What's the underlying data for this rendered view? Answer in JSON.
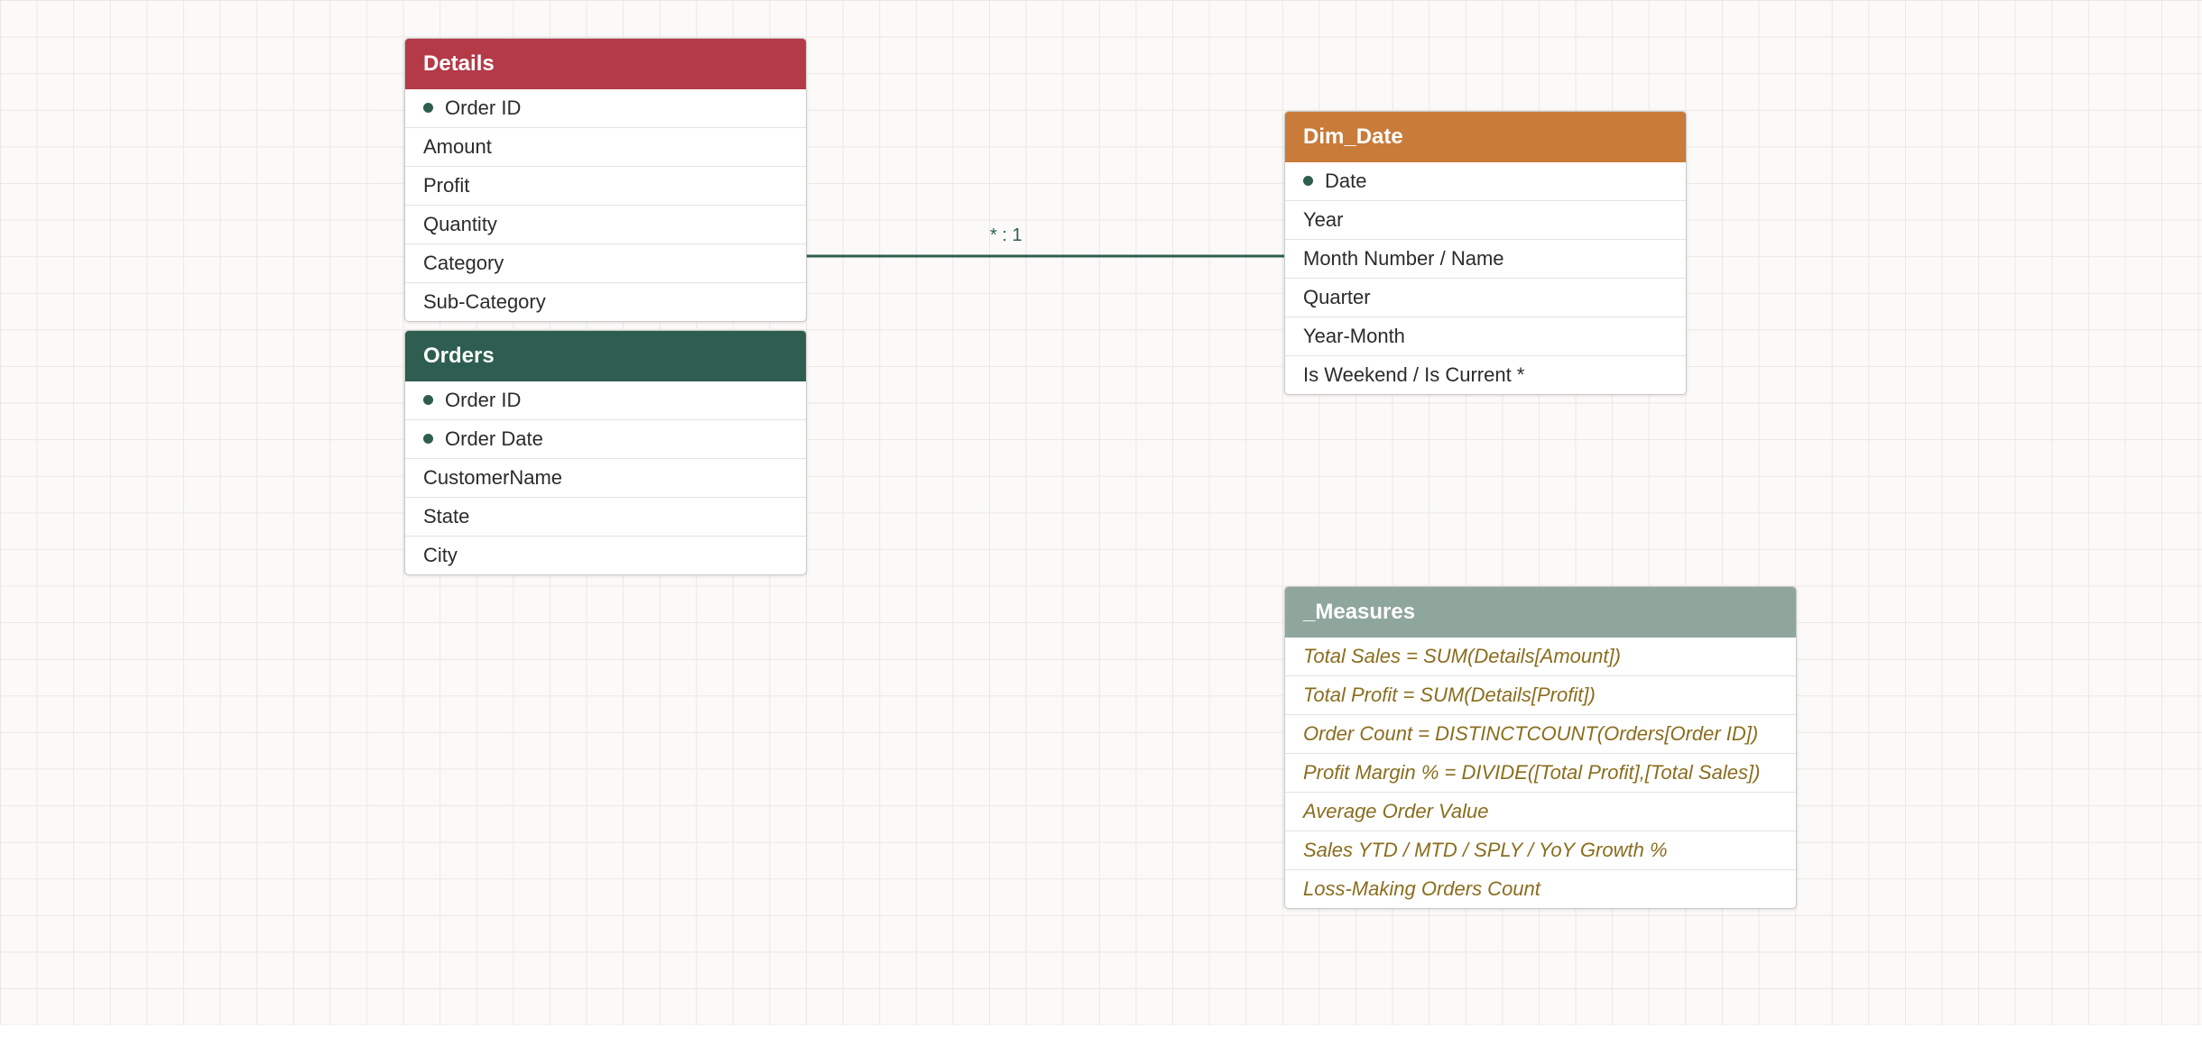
{
  "colors": {
    "key_dot": "#2d5e4f",
    "relationship_line": "#2d5e4f",
    "measure_text": "#8a6d1e"
  },
  "tables": {
    "details": {
      "title": "Details",
      "header_color": "#b43a48",
      "fields": [
        {
          "label": "Order ID",
          "key": true
        },
        {
          "label": "Amount",
          "key": false
        },
        {
          "label": "Profit",
          "key": false
        },
        {
          "label": "Quantity",
          "key": false
        },
        {
          "label": "Category",
          "key": false
        },
        {
          "label": "Sub-Category",
          "key": false
        }
      ]
    },
    "orders": {
      "title": "Orders",
      "header_color": "#2d5e4f",
      "fields": [
        {
          "label": "Order ID",
          "key": true
        },
        {
          "label": "Order Date",
          "key": true
        },
        {
          "label": "CustomerName",
          "key": false
        },
        {
          "label": "State",
          "key": false
        },
        {
          "label": "City",
          "key": false
        }
      ]
    },
    "dim_date": {
      "title": "Dim_Date",
      "header_color": "#c97b3a",
      "fields": [
        {
          "label": "Date",
          "key": true
        },
        {
          "label": "Year",
          "key": false
        },
        {
          "label": "Month Number / Name",
          "key": false
        },
        {
          "label": "Quarter",
          "key": false
        },
        {
          "label": "Year-Month",
          "key": false
        },
        {
          "label": "Is Weekend / Is Current *",
          "key": false
        }
      ]
    },
    "measures": {
      "title": "_Measures",
      "header_color": "#8fa69d",
      "fields": [
        {
          "label": "Total Sales = SUM(Details[Amount])",
          "key": false
        },
        {
          "label": "Total Profit = SUM(Details[Profit])",
          "key": false
        },
        {
          "label": "Order Count = DISTINCTCOUNT(Orders[Order ID])",
          "key": false
        },
        {
          "label": "Profit Margin % = DIVIDE([Total Profit],[Total Sales])",
          "key": false
        },
        {
          "label": "Average Order Value",
          "key": false
        },
        {
          "label": "Sales YTD / MTD / SPLY / YoY Growth %",
          "key": false
        },
        {
          "label": "Loss-Making Orders Count",
          "key": false
        }
      ]
    }
  },
  "relationship": {
    "label": "* : 1"
  }
}
